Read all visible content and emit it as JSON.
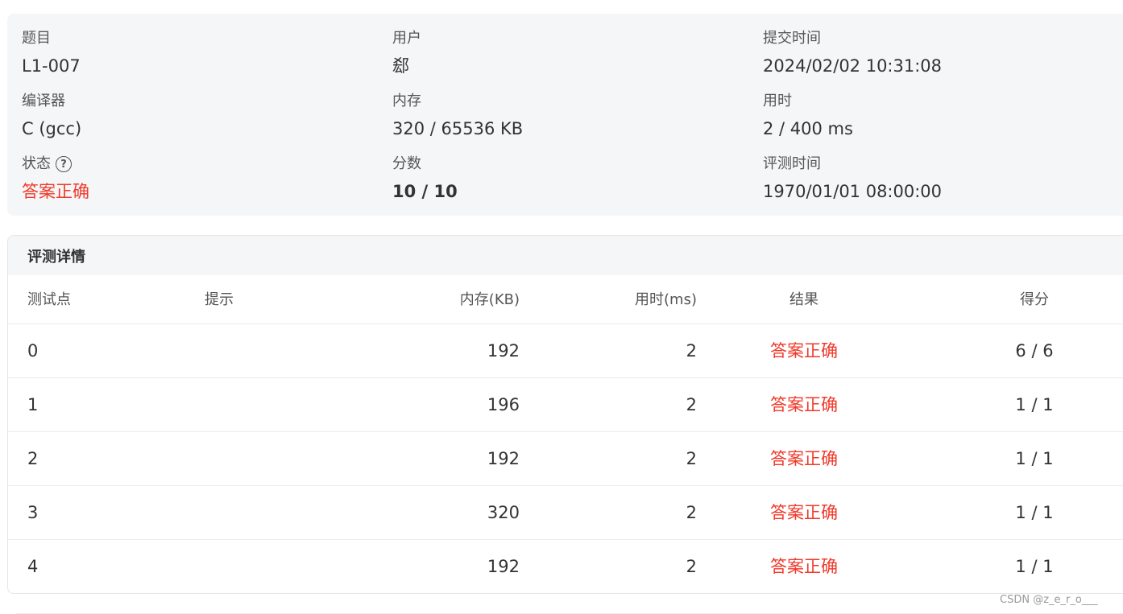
{
  "info": {
    "problem_label": "题目",
    "problem_value": "L1-007",
    "user_label": "用户",
    "user_value": "郄",
    "submit_time_label": "提交时间",
    "submit_time_value": "2024/02/02 10:31:08",
    "compiler_label": "编译器",
    "compiler_value": "C (gcc)",
    "memory_label": "内存",
    "memory_value": "320 / 65536 KB",
    "time_label": "用时",
    "time_value": "2 / 400 ms",
    "status_label": "状态",
    "status_help_icon": "question-circle-icon",
    "status_value": "答案正确",
    "score_label": "分数",
    "score_value": "10 / 10",
    "judge_time_label": "评测时间",
    "judge_time_value": "1970/01/01 08:00:00"
  },
  "details": {
    "title": "评测详情",
    "columns": {
      "case": "测试点",
      "hint": "提示",
      "memory": "内存(KB)",
      "time": "用时(ms)",
      "result": "结果",
      "score": "得分"
    },
    "rows": [
      {
        "case": "0",
        "hint": "",
        "memory": "192",
        "time": "2",
        "result": "答案正确",
        "score": "6 / 6"
      },
      {
        "case": "1",
        "hint": "",
        "memory": "196",
        "time": "2",
        "result": "答案正确",
        "score": "1 / 1"
      },
      {
        "case": "2",
        "hint": "",
        "memory": "192",
        "time": "2",
        "result": "答案正确",
        "score": "1 / 1"
      },
      {
        "case": "3",
        "hint": "",
        "memory": "320",
        "time": "2",
        "result": "答案正确",
        "score": "1 / 1"
      },
      {
        "case": "4",
        "hint": "",
        "memory": "192",
        "time": "2",
        "result": "答案正确",
        "score": "1 / 1"
      }
    ]
  },
  "watermark": "CSDN @z_e_r_o___",
  "colors": {
    "accent_red": "#f0392b",
    "card_bg": "#f5f6f7"
  }
}
